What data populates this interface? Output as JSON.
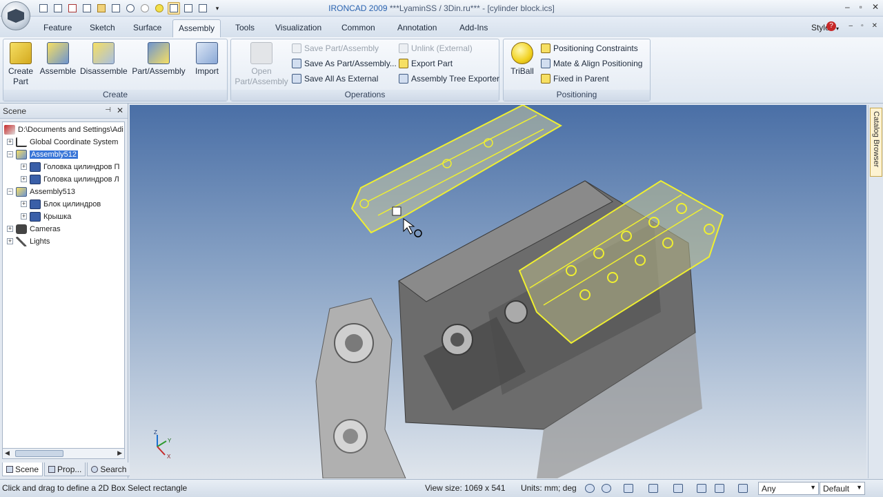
{
  "window": {
    "title_brand": "IRONCAD 2009",
    "title_rest": " ***LyaminSS / 3Din.ru*** - [cylinder block.ics]"
  },
  "ribbon": {
    "tabs": [
      "Feature",
      "Sketch",
      "Surface",
      "Assembly",
      "Tools",
      "Visualization",
      "Common",
      "Annotation",
      "Add-Ins"
    ],
    "active_tab": "Assembly",
    "styles_label": "Styles",
    "groups": {
      "create": {
        "name": "Create",
        "buttons": [
          "Create\nPart",
          "Assemble",
          "Disassemble",
          "Part/Assembly",
          "Import"
        ]
      },
      "operations": {
        "name": "Operations",
        "open_label": "Open\nPart/Assembly",
        "save_part_assembly": "Save Part/Assembly",
        "save_as": "Save As Part/Assembly...",
        "save_all_external": "Save All As External",
        "unlink_external": "Unlink (External)",
        "export_part": "Export Part",
        "assembly_tree_exporter": "Assembly Tree Exporter"
      },
      "positioning": {
        "name": "Positioning",
        "triball": "TriBall",
        "positioning_constraints": "Positioning Constraints",
        "mate_align": "Mate & Align Positioning",
        "fixed_in_parent": "Fixed in Parent"
      }
    }
  },
  "scene": {
    "header": "Scene",
    "tree": [
      {
        "label": "D:\\Documents and Settings\\Adi",
        "depth": 0,
        "expander": ""
      },
      {
        "label": "Global Coordinate System",
        "depth": 1,
        "expander": "+"
      },
      {
        "label": "Assembly512",
        "depth": 1,
        "expander": "−",
        "selected": true
      },
      {
        "label": "Головка цилиндров П",
        "depth": 2,
        "expander": "+"
      },
      {
        "label": "Головка цилиндров Л",
        "depth": 2,
        "expander": "+"
      },
      {
        "label": "Assembly513",
        "depth": 1,
        "expander": "−"
      },
      {
        "label": "Блок цилиндров",
        "depth": 2,
        "expander": "+"
      },
      {
        "label": "Крышка",
        "depth": 2,
        "expander": "+"
      },
      {
        "label": "Cameras",
        "depth": 1,
        "expander": "+"
      },
      {
        "label": "Lights",
        "depth": 1,
        "expander": "+"
      }
    ],
    "bottom_tabs": [
      "Scene",
      "Prop...",
      "Search"
    ]
  },
  "viewport": {
    "axis_labels": {
      "z": "Z",
      "y": "Y",
      "x": "X"
    },
    "catalog_label": "Catalog Browser"
  },
  "status": {
    "message": "Click and drag to define a 2D Box Select rectangle",
    "view_size": "View size: 1069 x  541",
    "units": "Units: mm; deg",
    "filter_value": "Any",
    "style_value": "Default"
  },
  "colors": {
    "selection_highlight": "#f0f030",
    "tree_selection": "#3875d7",
    "title_accent": "#2a63b0"
  }
}
